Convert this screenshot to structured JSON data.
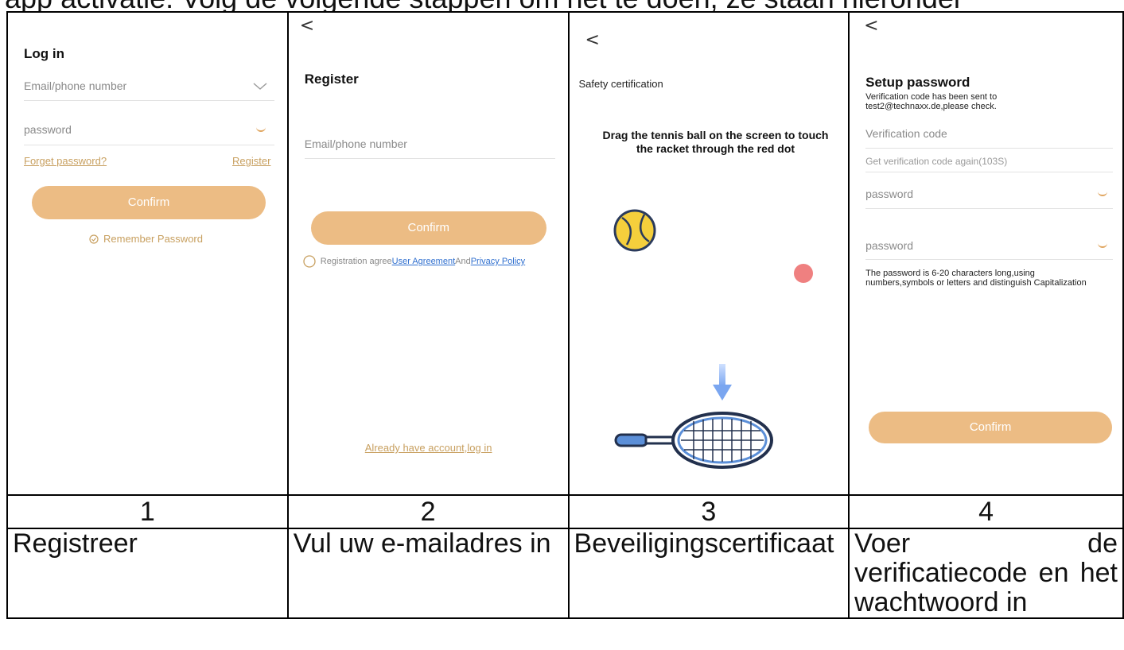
{
  "caption_top": "app activatie. Volg de volgende stappen om het te doen, ze staan hieronder",
  "panels": [
    {
      "number": "1",
      "description": "Registreer",
      "screen": {
        "title": "Log in",
        "email_placeholder": "Email/phone number",
        "password_placeholder": "password",
        "forget_link": "Forget password?",
        "register_link": "Register",
        "confirm_label": "Confirm",
        "remember_label": "Remember Password"
      }
    },
    {
      "number": "2",
      "description": "Vul uw e-mailadres in",
      "screen": {
        "back": "<",
        "title": "Register",
        "email_placeholder": "Email/phone number",
        "confirm_label": "Confirm",
        "agree_prefix": "Registration agree",
        "user_agreement": "User Agreement",
        "and": "And",
        "privacy_policy": "Privacy Policy",
        "login_link": "Already have account,log in"
      }
    },
    {
      "number": "3",
      "description": "Beveiligingscertificaat",
      "screen": {
        "back": "<",
        "title": "Safety certification",
        "instruction": "Drag the tennis ball on the screen to touch the racket through the red dot"
      }
    },
    {
      "number": "4",
      "description": "Voer de verificatiecode en het wachtwoord in",
      "screen": {
        "back": "<",
        "title": "Setup password",
        "sent_notice": "Verification code has been sent to test2@technaxx.de,please check.",
        "code_placeholder": "Verification code",
        "resend": "Get verification code again(103S)",
        "password_placeholder": "password",
        "password2_placeholder": "password",
        "rule_text": "The password is 6-20 characters long,using numbers,symbols or letters and distinguish Capitalization",
        "confirm_label": "Confirm"
      }
    }
  ],
  "colors": {
    "accent": "#ecbc84",
    "link": "#c8a060",
    "blue_link": "#2f6fcf",
    "red_dot": "#ef8080",
    "ball": "#f5cf3c"
  }
}
